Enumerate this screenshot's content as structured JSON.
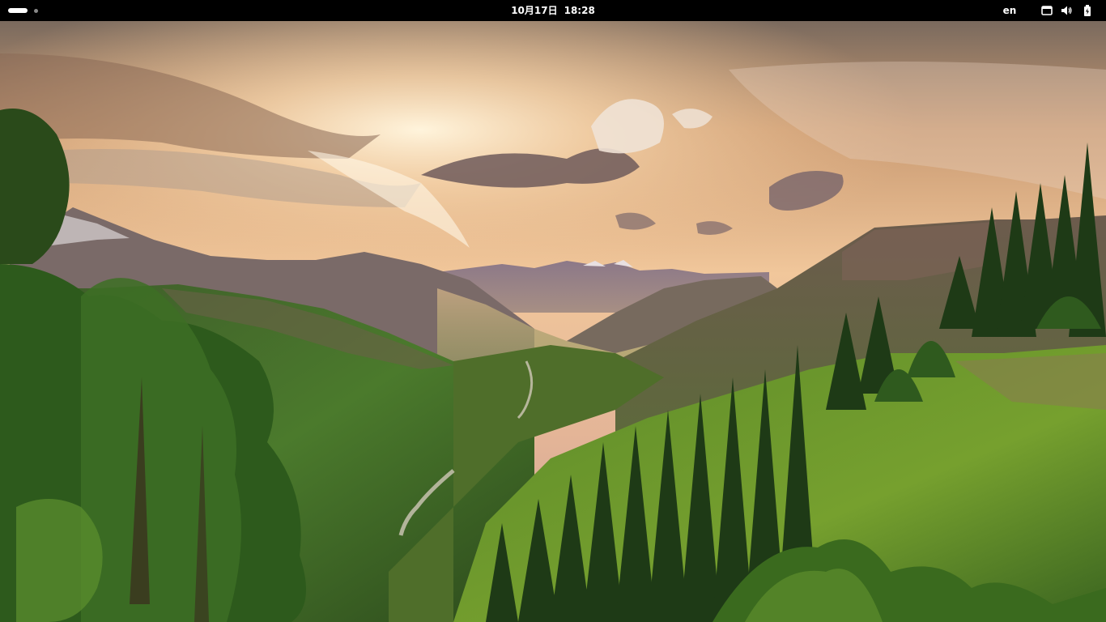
{
  "top_bar": {
    "clock": {
      "date": "10月17日",
      "time": "18:28"
    },
    "keyboard_layout": "en",
    "tray_icons": [
      "network-icon",
      "volume-icon",
      "battery-icon"
    ]
  },
  "desktop": {
    "wallpaper": "mountain-valley-sunset"
  }
}
